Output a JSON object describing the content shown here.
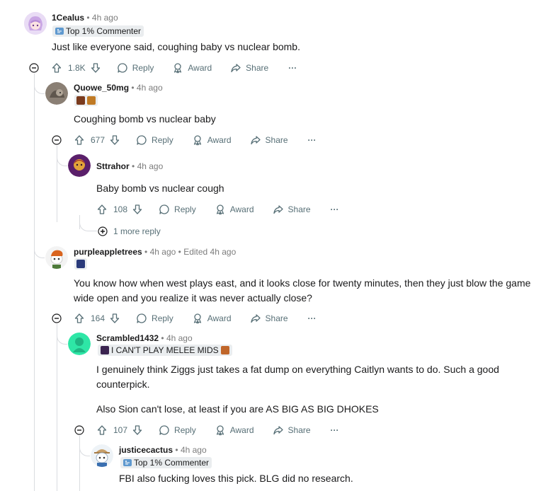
{
  "comments": {
    "c1": {
      "user": "1Cealus",
      "time": "4h ago",
      "flair": "Top 1% Commenter",
      "body": "Just like everyone said, coughing baby vs nuclear bomb.",
      "votes": "1.8K",
      "reply": "Reply",
      "award": "Award",
      "share": "Share",
      "more": "···"
    },
    "c2": {
      "user": "Quowe_50mg",
      "time": "4h ago",
      "body": "Coughing bomb vs nuclear baby",
      "votes": "677",
      "reply": "Reply",
      "award": "Award",
      "share": "Share",
      "more": "···"
    },
    "c3": {
      "user": "Sttrahor",
      "time": "4h ago",
      "body": "Baby bomb vs nuclear cough",
      "votes": "108",
      "reply": "Reply",
      "award": "Award",
      "share": "Share",
      "more": "···",
      "more_replies": "1 more reply"
    },
    "c4": {
      "user": "purpleappletrees",
      "time": "4h ago",
      "edited": "Edited 4h ago",
      "body": "You know how when west plays east, and it looks close for twenty minutes, then they just blow the game wide open and you realize it was never actually close?",
      "votes": "164",
      "reply": "Reply",
      "award": "Award",
      "share": "Share",
      "more": "···"
    },
    "c5": {
      "user": "Scrambled1432",
      "time": "4h ago",
      "flair": "I CAN'T PLAY MELEE MIDS",
      "body1": "I genuinely think Ziggs just takes a fat dump on everything Caitlyn wants to do. Such a good counterpick.",
      "body2": "Also Sion can't lose, at least if you are AS BIG AS BIG DHOKES",
      "votes": "107",
      "reply": "Reply",
      "award": "Award",
      "share": "Share",
      "more": "···"
    },
    "c6": {
      "user": "justicecactus",
      "time": "4h ago",
      "flair": "Top 1% Commenter",
      "body": "FBI also fucking loves this pick. BLG did no research."
    }
  },
  "separator": "•",
  "colors": {
    "text": "#1a1a1b",
    "meta": "#7c7c7c",
    "action": "#576f76",
    "thread": "#dadce0",
    "flair_bg": "#eaedef"
  }
}
